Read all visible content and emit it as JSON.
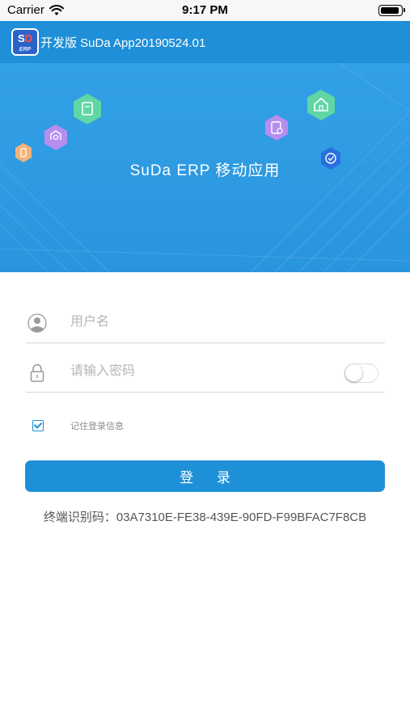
{
  "status_bar": {
    "carrier": "Carrier",
    "time": "9:17 PM"
  },
  "header": {
    "logo_letters_1": "S",
    "logo_letters_2": "D",
    "logo_sub": "ERP",
    "title": "开发版 SuDa App20190524.01"
  },
  "banner": {
    "title": "SuDa ERP 移动应用"
  },
  "form": {
    "username_placeholder": "用户名",
    "password_placeholder": "请输入密码",
    "password_visible": false,
    "remember_label": "记住登录信息",
    "remember_checked": true
  },
  "login_button": {
    "label": "登 录"
  },
  "device": {
    "label": "终端识别码：03A7310E-FE38-439E-90FD-F99BFAC7F8CB"
  },
  "colors": {
    "primary": "#1e8fd8",
    "banner": "#2f9de4"
  }
}
